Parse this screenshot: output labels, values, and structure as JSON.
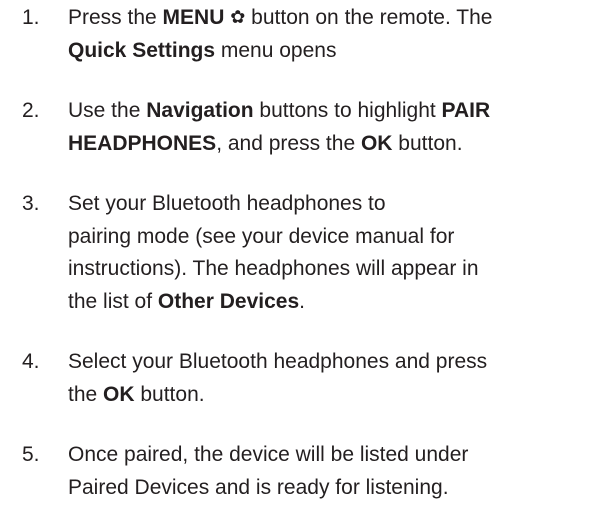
{
  "steps": [
    {
      "number": "1.",
      "lines": [
        [
          "Press the ",
          "MENU",
          " ",
          "✿",
          " button on the remote. The"
        ],
        [
          "Quick Settings",
          " menu opens"
        ]
      ]
    },
    {
      "number": "2.",
      "lines": [
        [
          "Use the ",
          "Navigation",
          " buttons to highlight ",
          "PAIR"
        ],
        [
          "HEADPHONES",
          ", and press the ",
          "OK",
          " button."
        ]
      ]
    },
    {
      "number": "3.",
      "lines": [
        [
          "Set your Bluetooth headphones to"
        ],
        [
          "pairing mode (see your device manual for"
        ],
        [
          "instructions). The headphones will appear in"
        ],
        [
          "the list of ",
          "Other Devices",
          "."
        ]
      ]
    },
    {
      "number": "4.",
      "lines": [
        [
          "Select your Bluetooth headphones and press"
        ],
        [
          "the ",
          "OK",
          " button."
        ]
      ]
    },
    {
      "number": "5.",
      "lines": [
        [
          "Once paired, the device will be listed under"
        ],
        [
          "Paired Devices and is ready for listening."
        ]
      ]
    }
  ]
}
